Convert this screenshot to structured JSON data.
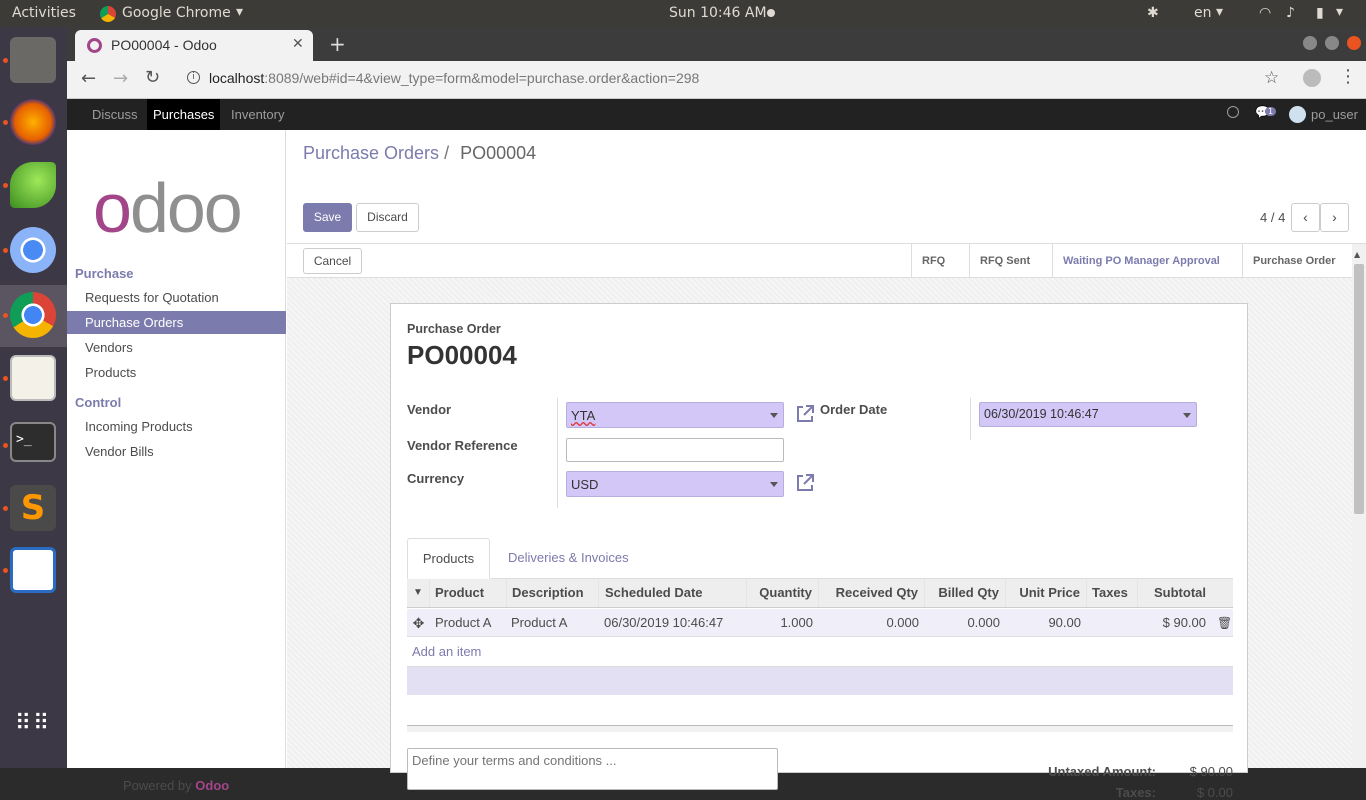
{
  "os": {
    "activities": "Activities",
    "app_menu": "Google Chrome",
    "clock": "Sun 10:46 AM",
    "lang": "en"
  },
  "browser": {
    "tab_title": "PO00004 - Odoo",
    "url_host": "localhost",
    "url_rest": ":8089/web#id=4&view_type=form&model=purchase.order&action=298"
  },
  "topnav": {
    "items": [
      "Discuss",
      "Purchases",
      "Inventory"
    ],
    "active": "Purchases",
    "chat_count": "1",
    "user": "po_user"
  },
  "sidebar": {
    "logo_text": "odoo",
    "sections": [
      {
        "title": "Purchase",
        "items": [
          "Requests for Quotation",
          "Purchase Orders",
          "Vendors",
          "Products"
        ]
      },
      {
        "title": "Control",
        "items": [
          "Incoming Products",
          "Vendor Bills"
        ]
      }
    ],
    "active_item": "Purchase Orders",
    "powered_by": "Powered by",
    "powered_brand": "Odoo"
  },
  "control_panel": {
    "breadcrumb_parent": "Purchase Orders",
    "breadcrumb_sep": "/",
    "breadcrumb_current": "PO00004",
    "save_label": "Save",
    "discard_label": "Discard",
    "pager": "4 / 4"
  },
  "statusbar": {
    "cancel_label": "Cancel",
    "stages": [
      "RFQ",
      "RFQ Sent",
      "Waiting PO Manager Approval",
      "Purchase Order"
    ],
    "active_stage": "Waiting PO Manager Approval"
  },
  "form": {
    "doc_type": "Purchase Order",
    "name": "PO00004",
    "vendor_label": "Vendor",
    "vendor_value": "YTA",
    "vendor_ref_label": "Vendor Reference",
    "vendor_ref_value": "",
    "currency_label": "Currency",
    "currency_value": "USD",
    "order_date_label": "Order Date",
    "order_date_value": "06/30/2019 10:46:47",
    "tabs": [
      "Products",
      "Deliveries & Invoices"
    ],
    "active_tab": "Products",
    "lines": {
      "columns": [
        "Product",
        "Description",
        "Scheduled Date",
        "Quantity",
        "Received Qty",
        "Billed Qty",
        "Unit Price",
        "Taxes",
        "Subtotal"
      ],
      "rows": [
        {
          "product": "Product A",
          "description": "Product A",
          "scheduled_date": "06/30/2019 10:46:47",
          "quantity": "1.000",
          "received_qty": "0.000",
          "billed_qty": "0.000",
          "unit_price": "90.00",
          "taxes": "",
          "subtotal": "$ 90.00"
        }
      ],
      "add_item": "Add an item"
    },
    "terms_placeholder": "Define your terms and conditions ...",
    "untaxed_label": "Untaxed Amount:",
    "untaxed_value": "$ 90.00",
    "taxes_label": "Taxes:",
    "taxes_value": "$ 0.00"
  },
  "colors": {
    "brand": "#7c7bad",
    "select_bg": "#d2c7f6",
    "odoo_pink": "#a24689"
  }
}
